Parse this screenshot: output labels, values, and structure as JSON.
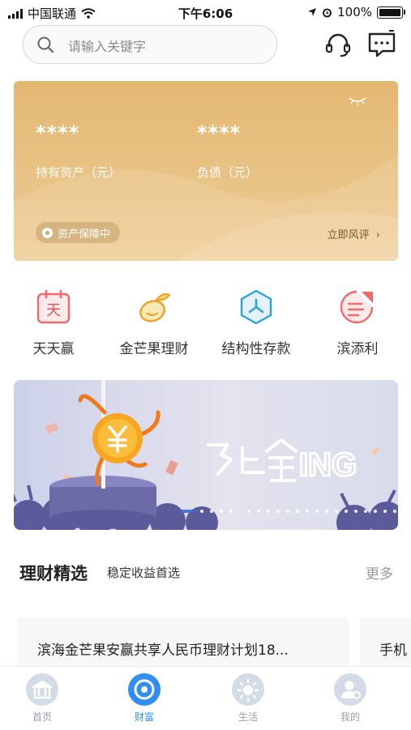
{
  "status_bar": {
    "carrier": "中国联通",
    "time": "下午6:06",
    "battery": "100%"
  },
  "search": {
    "placeholder": "请输入关键字"
  },
  "header_icons": [
    "headset-icon",
    "message-icon"
  ],
  "asset_card": {
    "holdings_masked": "****",
    "holdings_label": "持有资产（元）",
    "liabilities_masked": "****",
    "liabilities_label": "负债（元）",
    "protection_label": "资产保障中",
    "risk_link": "立即风评",
    "colors": {
      "card": "#e6be7e",
      "text": "#ffffff"
    }
  },
  "quick_entries": [
    {
      "label": "天天赢",
      "icon": "calendar-tian-icon",
      "glyph": "天"
    },
    {
      "label": "金芒果理财",
      "icon": "mango-icon"
    },
    {
      "label": "结构性存款",
      "icon": "hexagon-structure-icon"
    },
    {
      "label": "滨添利",
      "icon": "document-list-icon"
    }
  ],
  "banner": {
    "slogan": "马上金ING",
    "active_page": 1,
    "page_count": 5
  },
  "section": {
    "title": "理财精选",
    "subtitle": "稳定收益首选",
    "more": "更多"
  },
  "products": [
    {
      "name": "滨海金芒果安赢共享人民币理财计划18..."
    },
    {
      "name": "手机"
    }
  ],
  "tabbar": {
    "items": [
      {
        "label": "首页",
        "icon": "bank-icon",
        "active": false
      },
      {
        "label": "财富",
        "icon": "wealth-icon",
        "active": true
      },
      {
        "label": "生活",
        "icon": "sun-icon",
        "active": false
      },
      {
        "label": "我的",
        "icon": "user-icon",
        "active": false
      }
    ],
    "active_color": "#2f8ef0"
  }
}
